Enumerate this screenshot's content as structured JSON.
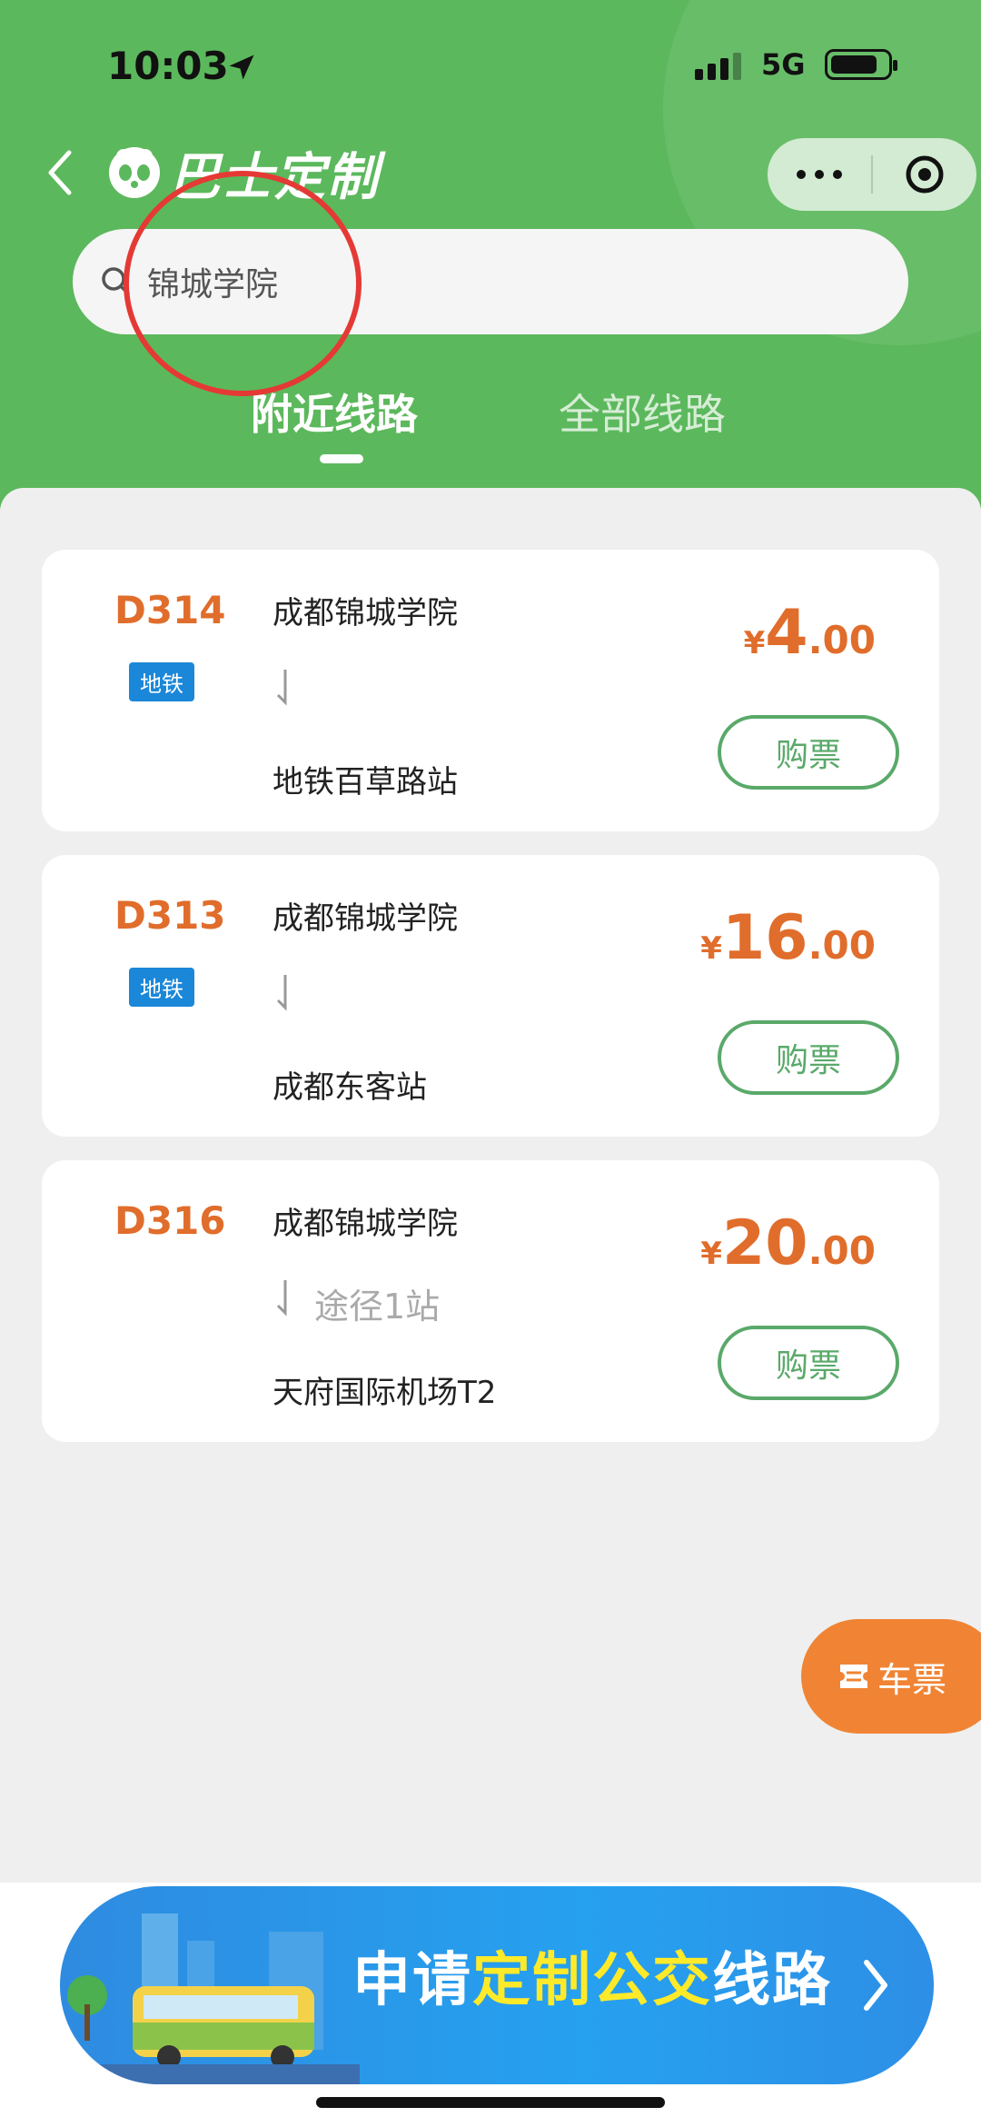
{
  "status_bar": {
    "time": "10:03",
    "network": "5G"
  },
  "header": {
    "app_name": "巴士定制",
    "search": {
      "value": "锦城学院"
    },
    "tabs": [
      {
        "label": "附近线路",
        "active": true
      },
      {
        "label": "全部线路",
        "active": false
      }
    ]
  },
  "routes": [
    {
      "code": "D314",
      "tag": "地铁",
      "from": "成都锦城学院",
      "via": "",
      "to": "地铁百草路站",
      "currency": "¥",
      "price_int": "4",
      "price_dec": ".00",
      "buy_label": "购票"
    },
    {
      "code": "D313",
      "tag": "地铁",
      "from": "成都锦城学院",
      "via": "",
      "to": "成都东客站",
      "currency": "¥",
      "price_int": "16",
      "price_dec": ".00",
      "buy_label": "购票"
    },
    {
      "code": "D316",
      "tag": "",
      "from": "成都锦城学院",
      "via": "途径1站",
      "to": "天府国际机场T2",
      "currency": "¥",
      "price_int": "20",
      "price_dec": ".00",
      "buy_label": "购票"
    }
  ],
  "ticket_fab": {
    "label": "车票"
  },
  "banner": {
    "part1": "申请",
    "part2": "定制公交",
    "part3": "线路"
  },
  "colors": {
    "header_green": "#5cb85c",
    "accent_orange": "#e06d2b",
    "buy_green": "#5aa96a",
    "metro_blue": "#1b87d8",
    "annotation_red": "#e53935"
  },
  "icons": [
    "back-arrow-icon",
    "panda-logo-icon",
    "more-dots-icon",
    "target-icon",
    "search-icon",
    "down-arrow-icon",
    "ticket-icon",
    "chevron-right-icon"
  ]
}
